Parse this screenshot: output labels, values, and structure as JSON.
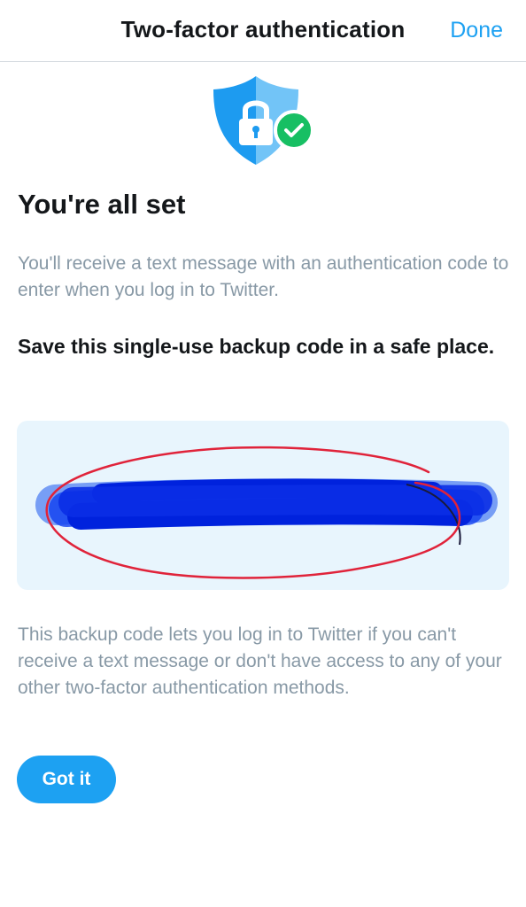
{
  "header": {
    "title": "Two-factor authentication",
    "done_label": "Done"
  },
  "icons": {
    "shield": "shield-lock-icon",
    "check": "check-badge-icon"
  },
  "main": {
    "heading": "You're all set",
    "description": "You'll receive a text message with an authentication code to enter when you log in to Twitter.",
    "save_note": "Save this single-use backup code in a safe place.",
    "backup_code": "",
    "explanation": "This backup code lets you log in to Twitter if you can't receive a text message or don't have access to any of your other two-factor authentication methods.",
    "button_label": "Got it"
  },
  "colors": {
    "accent": "#1da1f2",
    "success": "#17bf63",
    "code_background": "#e8f5fd",
    "redaction": "#0022dd",
    "annotation": "#e0233a"
  }
}
